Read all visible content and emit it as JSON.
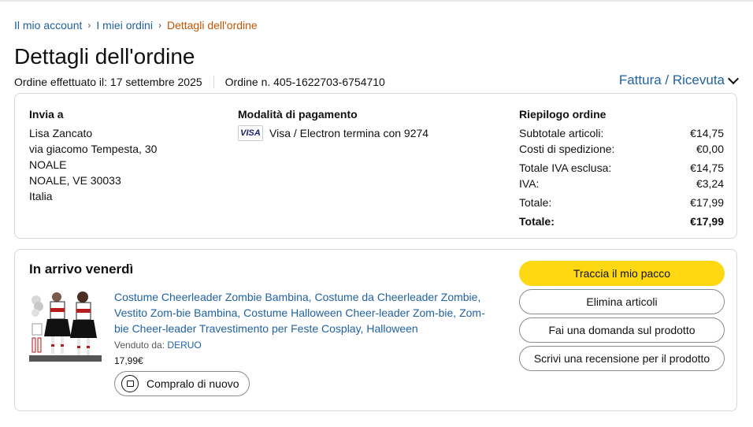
{
  "breadcrumb": {
    "account": "Il mio account",
    "orders": "I miei ordini",
    "current": "Dettagli dell'ordine",
    "separator": "›"
  },
  "page": {
    "title": "Dettagli dell'ordine",
    "order_date": "Ordine effettuato il: 17 settembre 2025",
    "order_number": "Ordine n. 405-1622703-6754710",
    "invoice_link": "Fattura / Ricevuta"
  },
  "shipping": {
    "heading": "Invia a",
    "name": "Lisa Zancato",
    "street": "via giacomo Tempesta, 30",
    "city1": "NOALE",
    "city2": "NOALE, VE 30033",
    "country": "Italia"
  },
  "payment": {
    "heading": "Modalità di pagamento",
    "card_logo": "VISA",
    "card_text": "Visa / Electron termina con 9274"
  },
  "summary": {
    "heading": "Riepilogo ordine",
    "rows": [
      {
        "label": "Subtotale articoli:",
        "value": "€14,75"
      },
      {
        "label": "Costi di spedizione:",
        "value": "€0,00"
      },
      {
        "label": "Totale IVA esclusa:",
        "value": "€14,75"
      },
      {
        "label": "IVA:",
        "value": "€3,24"
      },
      {
        "label": "Totale:",
        "value": "€17,99"
      },
      {
        "label": "Totale:",
        "value": "€17,99"
      }
    ]
  },
  "shipment": {
    "arrival": "In arrivo venerdì",
    "product_title": "Costume Cheerleader Zombie Bambina, Costume da Cheerleader Zombie, Vestito Zom-bie Bambina, Costume Halloween Cheer-leader Zom-bie, Zom-bie Cheer-leader Travestimento per Feste Cosplay, Halloween",
    "seller_label": "Venduto da:",
    "seller_name": "DERUO",
    "price": "17,99€",
    "buy_again": "Compralo di nuovo",
    "buttons": {
      "track": "Traccia il mio pacco",
      "remove": "Elimina articoli",
      "question": "Fai una domanda sul prodotto",
      "review": "Scrivi una recensione per il prodotto"
    }
  },
  "colors": {
    "link": "#2162a1",
    "current_crumb": "#c45500",
    "primary_button": "#ffd814",
    "border": "#d5d9d9"
  },
  "icons": [
    "chevron-down-icon",
    "visa-logo",
    "buy-again-icon"
  ]
}
